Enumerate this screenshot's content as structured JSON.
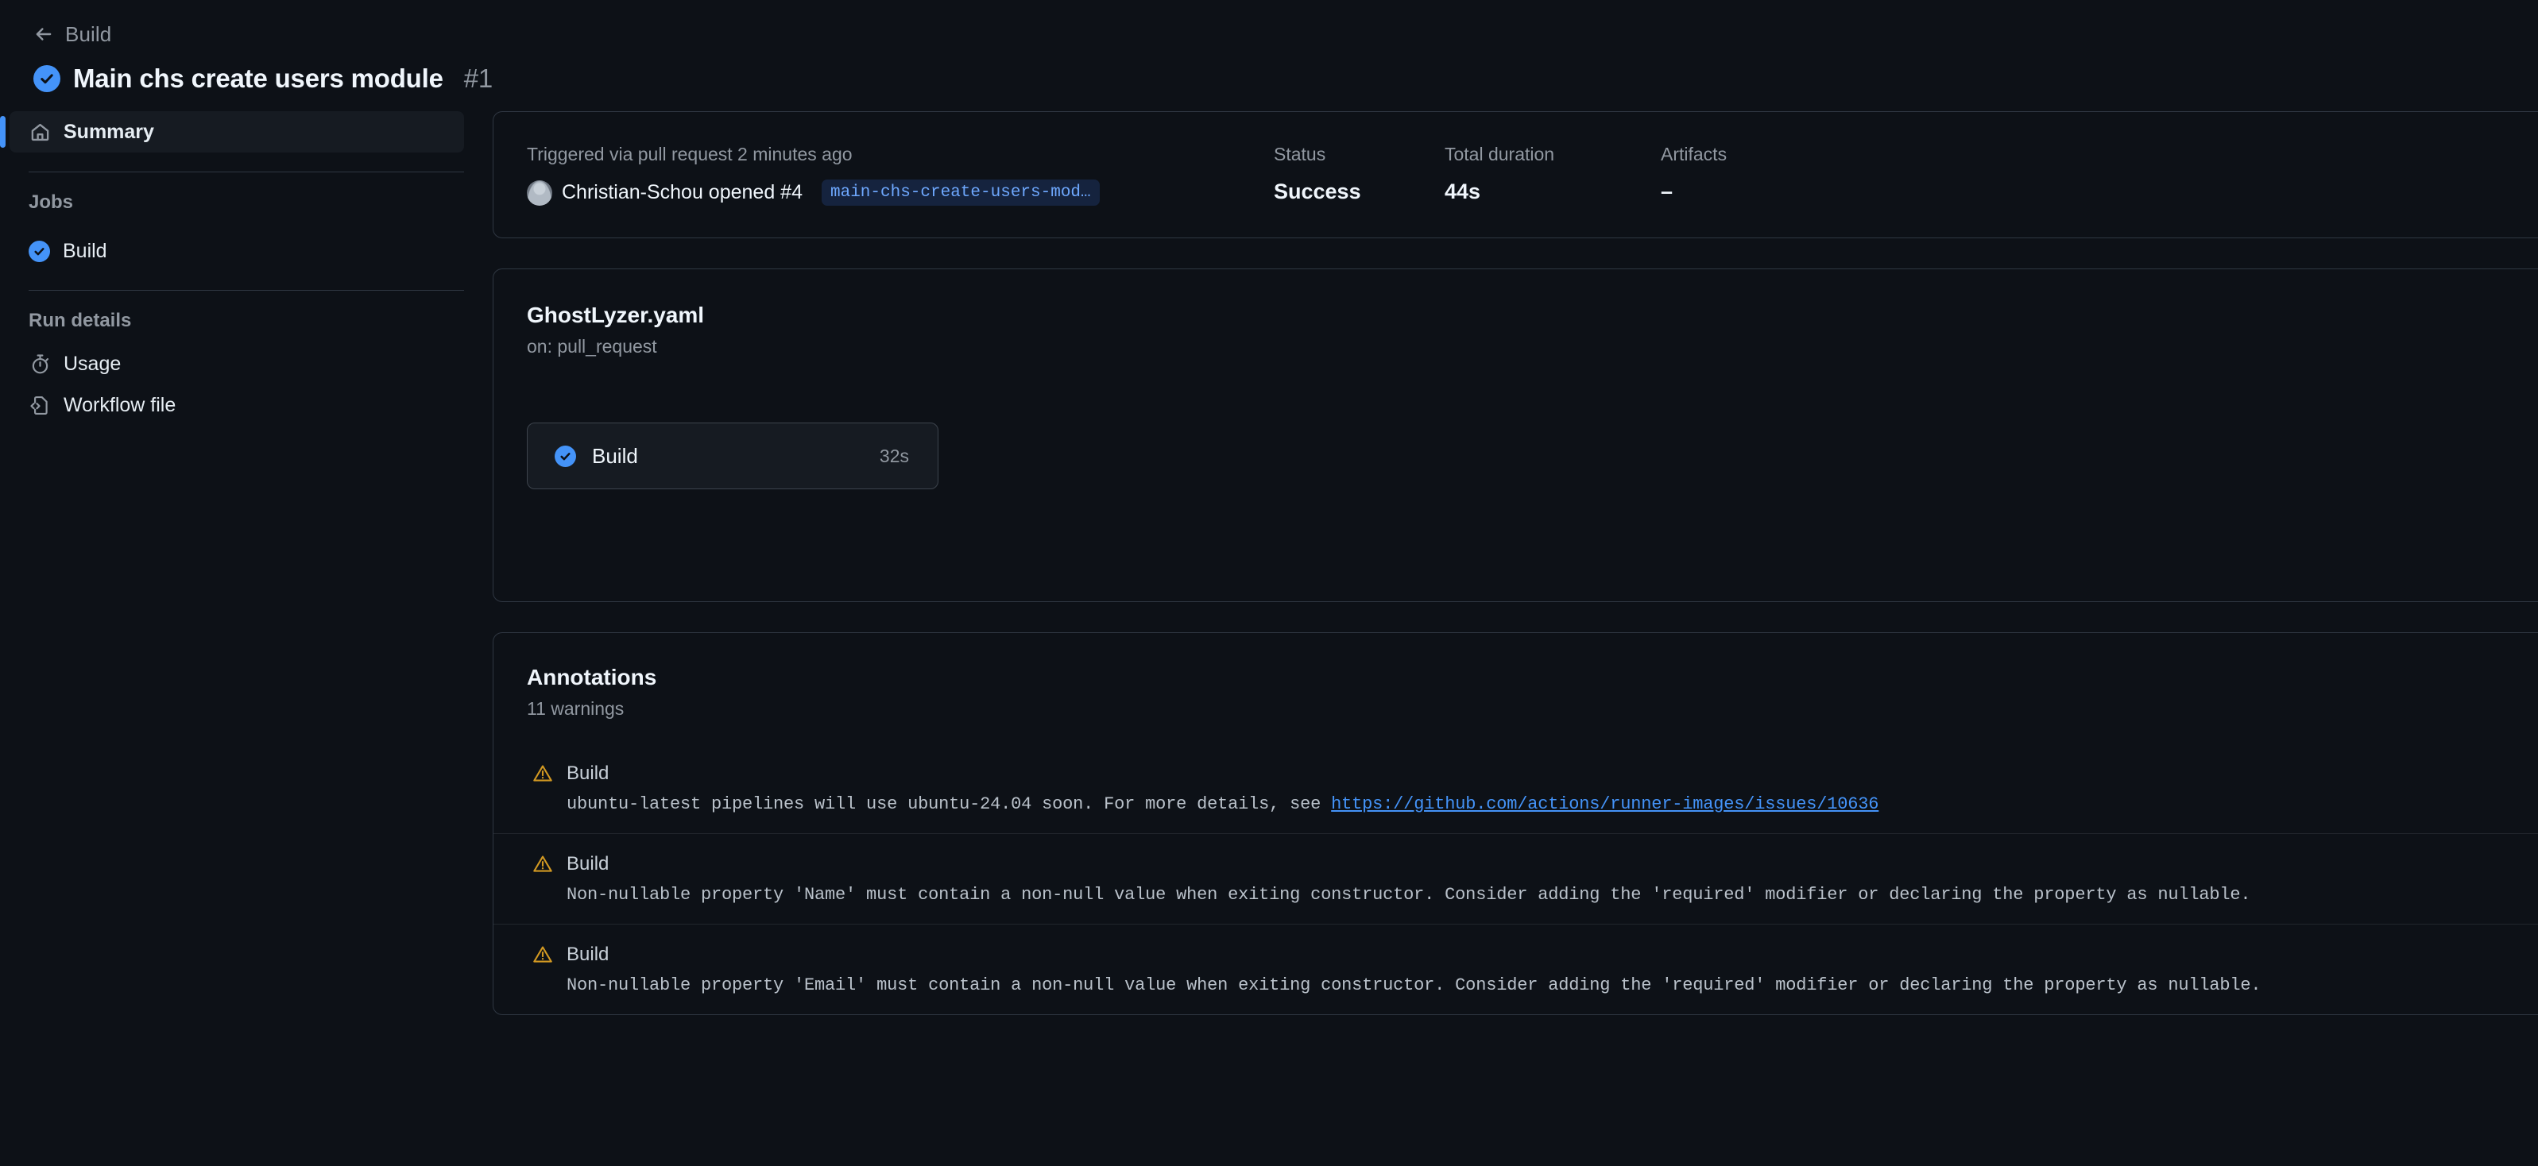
{
  "header": {
    "back_label": "Build",
    "back_icon": "arrow-left-icon",
    "status_icon": "check-circle-icon",
    "run_title": "Main chs create users module",
    "run_number": "#1"
  },
  "sidebar": {
    "summary": {
      "label": "Summary",
      "icon": "home-icon"
    },
    "jobs_section_label": "Jobs",
    "jobs": [
      {
        "label": "Build",
        "icon": "check-circle-icon"
      }
    ],
    "run_details_section_label": "Run details",
    "run_details": [
      {
        "label": "Usage",
        "icon": "stopwatch-icon"
      },
      {
        "label": "Workflow file",
        "icon": "file-code-icon"
      }
    ]
  },
  "summary_card": {
    "trigger_text": "Triggered via pull request 2 minutes ago",
    "actor": "Christian-Schou opened #4",
    "avatar_icon": "avatar",
    "branch_chip": "main-chs-create-users-mod…",
    "stats": [
      {
        "label": "Status",
        "value": "Success"
      },
      {
        "label": "Total duration",
        "value": "44s"
      },
      {
        "label": "Artifacts",
        "value": "–"
      }
    ]
  },
  "workflow_card": {
    "file_name": "GhostLyzer.yaml",
    "trigger_on": "on: pull_request",
    "job_node": {
      "icon": "check-circle-icon",
      "name": "Build",
      "duration": "32s"
    }
  },
  "annotations": {
    "title": "Annotations",
    "count_text": "11 warnings",
    "items": [
      {
        "icon": "warning-triangle-icon",
        "job": "Build",
        "message": "ubuntu-latest pipelines will use ubuntu-24.04 soon. For more details, see ",
        "link": "https://github.com/actions/runner-images/issues/10636"
      },
      {
        "icon": "warning-triangle-icon",
        "job": "Build",
        "message": "Non-nullable property 'Name' must contain a non-null value when exiting constructor. Consider adding the 'required' modifier or declaring the property as nullable.",
        "link": ""
      },
      {
        "icon": "warning-triangle-icon",
        "job": "Build",
        "message": "Non-nullable property 'Email' must contain a non-null value when exiting constructor. Consider adding the 'required' modifier or declaring the property as nullable.",
        "link": ""
      }
    ]
  },
  "colors": {
    "background": "#0d1117",
    "accent_blue": "#4493f8",
    "warning_yellow": "#d29922",
    "muted_text": "#9198a1"
  }
}
